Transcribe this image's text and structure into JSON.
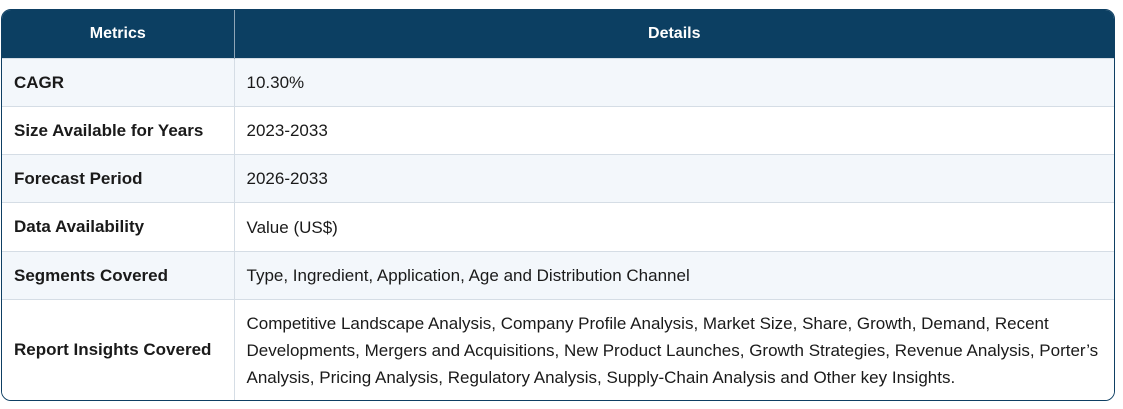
{
  "table": {
    "headers": {
      "metrics": "Metrics",
      "details": "Details"
    },
    "rows": [
      {
        "metric": "CAGR",
        "detail": "10.30%"
      },
      {
        "metric": "Size Available for Years",
        "detail": "2023-2033"
      },
      {
        "metric": "Forecast Period",
        "detail": "2026-2033"
      },
      {
        "metric": "Data Availability",
        "detail": "Value (US$)"
      },
      {
        "metric": "Segments Covered",
        "detail": "Type, Ingredient, Application, Age and Distribution Channel"
      },
      {
        "metric": "Report Insights Covered",
        "detail": "Competitive Landscape Analysis, Company Profile Analysis, Market Size, Share, Growth, Demand, Recent Developments, Mergers and Acquisitions, New Product Launches, Growth Strategies, Revenue Analysis, Porter’s Analysis, Pricing Analysis, Regulatory Analysis, Supply-Chain Analysis and Other key Insights."
      }
    ]
  }
}
